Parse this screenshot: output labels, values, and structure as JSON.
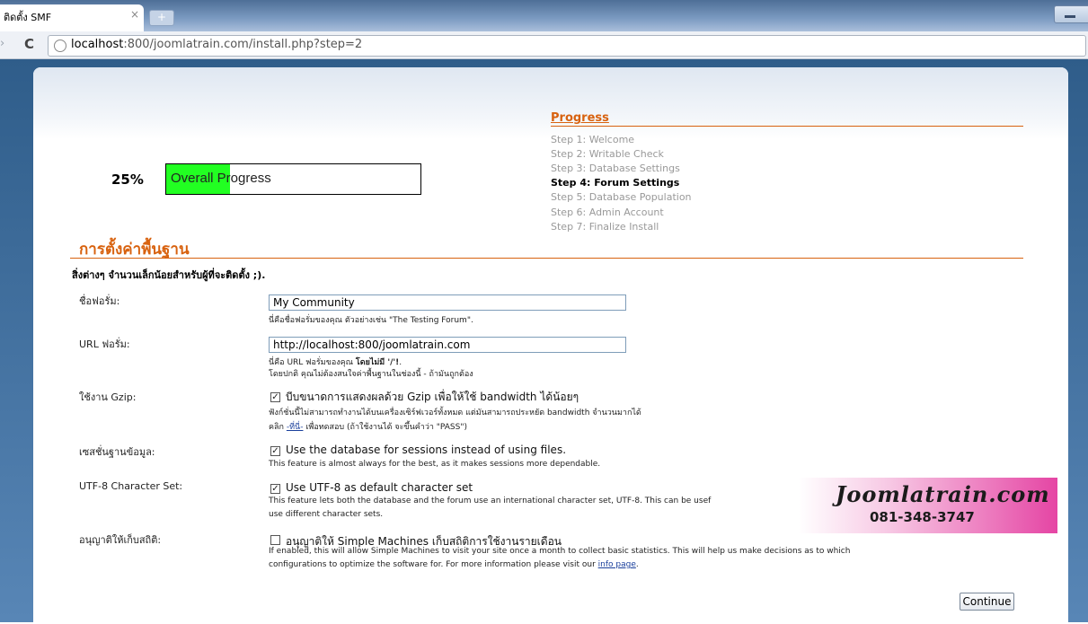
{
  "browser": {
    "tab_title": "ติดตั้ง SMF",
    "tab_close": "×",
    "new_tab": "+",
    "reload": "C",
    "back": "›",
    "url_host": "localhost",
    "url_path": ":800/joomlatrain.com/install.php?step=2"
  },
  "progress": {
    "percent_label": "25%",
    "percent_value": 0.25,
    "bar_label": "Overall Progress",
    "title": "Progress",
    "steps": [
      "Step 1: Welcome",
      "Step 2: Writable Check",
      "Step 3: Database Settings",
      "Step 4: Forum Settings",
      "Step 5: Database Population",
      "Step 6: Admin Account",
      "Step 7: Finalize Install"
    ],
    "current_step": 4
  },
  "section": {
    "title": "การตั้งค่าพื้นฐาน",
    "intro": "สิ่งต่างๆ จำนวนเล็กน้อยสำหรับผู้ที่จะติดตั้ง ;)."
  },
  "fields": {
    "forum_name": {
      "label": "ชื่อฟอรั่ม:",
      "value": "My Community",
      "help": "นี่คือชื่อฟอรั่มของคุณ ตัวอย่างเช่น \"The Testing Forum\"."
    },
    "forum_url": {
      "label": "URL ฟอรั่ม:",
      "value": "http://localhost:800/joomlatrain.com",
      "help_prefix": "นี่คือ URL ฟอรั่มของคุณ ",
      "help_bold": "โดยไม่มี '/'!",
      "help_suffix": ".",
      "help_line2": "โดยปกติ คุณไม่ต้องสนใจค่าพื้นฐานในช่องนี้ - ถ้ามันถูกต้อง"
    },
    "gzip": {
      "label": "ใช้งาน Gzip:",
      "checked": true,
      "check_mark": "✓",
      "text": "บีบขนาดการแสดงผลด้วย Gzip เพื่อให้ใช้ bandwidth ได้น้อยๆ",
      "help1": "ฟังก์ชั่นนี้ไม่สามารถทำงานได้บนเครื่องเซิร์ฟเวอร์ทั้งหมด แต่มันสามารถประหยัด bandwidth จำนวนมากได้",
      "help2_prefix": "คลิก ",
      "help2_link": "-ที่นี่-",
      "help2_suffix": " เพื่อทดสอบ (ถ้าใช้งานได้ จะขึ้นคำว่า \"PASS\")"
    },
    "db_sessions": {
      "label": "เซสชั่นฐานข้อมูล:",
      "checked": true,
      "check_mark": "✓",
      "text": "Use the database for sessions instead of using files.",
      "help": "This feature is almost always for the best, as it makes sessions more dependable."
    },
    "utf8": {
      "label": "UTF-8 Character Set:",
      "checked": true,
      "check_mark": "✓",
      "text": "Use UTF-8 as default character set",
      "help1": "This feature lets both the database and the forum use an international character set, UTF-8. This can be usef",
      "help2": "use different character sets."
    },
    "stats": {
      "label": "อนุญาติให้เก็บสถิติ:",
      "checked": false,
      "text": "อนุญาติให้ Simple Machines เก็บสถิติการใช้งานรายเดือน",
      "help1": "If enabled, this will allow Simple Machines to visit your site once a month to collect basic statistics. This will help us make decisions as to which",
      "help2_prefix": "configurations to optimize the software for. For more information please visit our ",
      "help2_link": "info page",
      "help2_suffix": "."
    }
  },
  "ad": {
    "name": "Joomlatrain.com",
    "phone": "081-348-3747"
  },
  "continue_label": "Continue"
}
